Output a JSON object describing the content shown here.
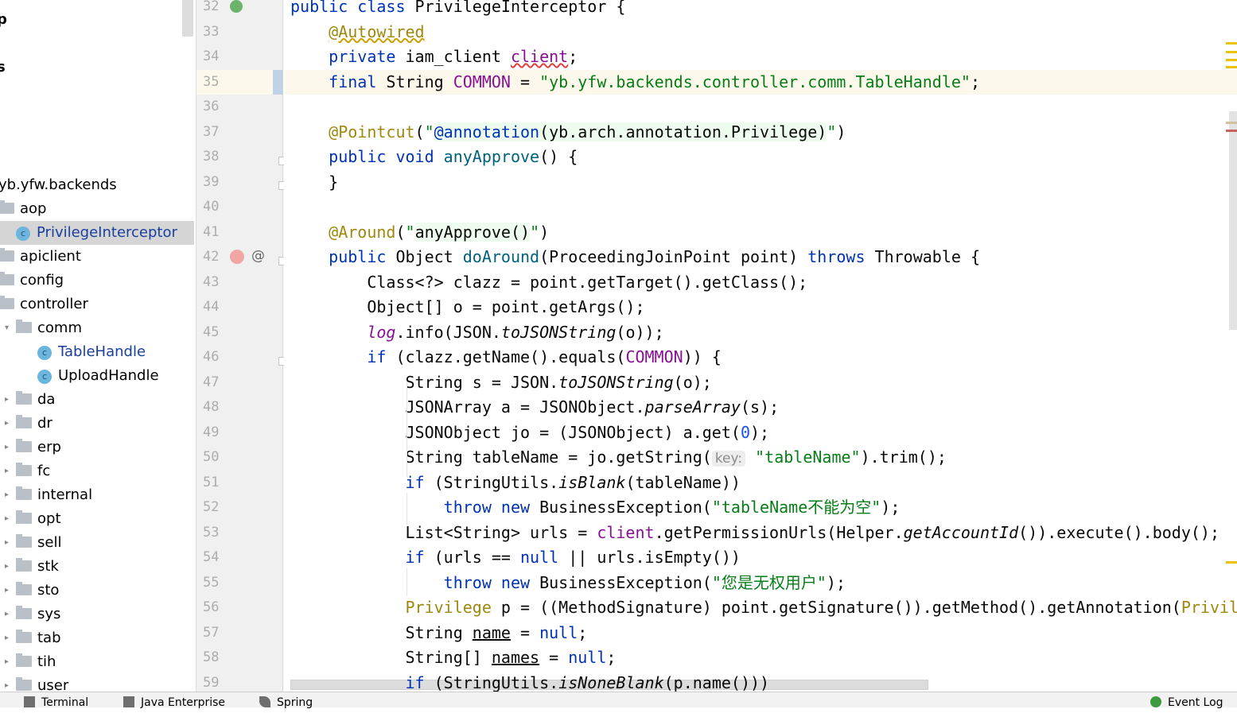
{
  "project_tree": {
    "items": [
      {
        "label": "p",
        "type": "partial",
        "indent": 0,
        "bold": true
      },
      {
        "label": "s",
        "type": "partial",
        "indent": 0,
        "bold": true
      },
      {
        "label": "yb.yfw.backends",
        "type": "package",
        "indent": 0
      },
      {
        "label": "aop",
        "type": "folder",
        "indent": 0,
        "expanded": true
      },
      {
        "label": "PrivilegeInterceptor",
        "type": "class",
        "indent": 1,
        "selected": true
      },
      {
        "label": "apiclient",
        "type": "folder",
        "indent": 0
      },
      {
        "label": "config",
        "type": "folder",
        "indent": 0
      },
      {
        "label": "controller",
        "type": "folder",
        "indent": 0
      },
      {
        "label": "comm",
        "type": "folder",
        "indent": 1,
        "expanded": true
      },
      {
        "label": "TableHandle",
        "type": "class",
        "indent": 2
      },
      {
        "label": "UploadHandle",
        "type": "class",
        "indent": 2
      },
      {
        "label": "da",
        "type": "folder",
        "indent": 1
      },
      {
        "label": "dr",
        "type": "folder",
        "indent": 1
      },
      {
        "label": "erp",
        "type": "folder",
        "indent": 1
      },
      {
        "label": "fc",
        "type": "folder",
        "indent": 1
      },
      {
        "label": "internal",
        "type": "folder",
        "indent": 1
      },
      {
        "label": "opt",
        "type": "folder",
        "indent": 1
      },
      {
        "label": "sell",
        "type": "folder",
        "indent": 1
      },
      {
        "label": "stk",
        "type": "folder",
        "indent": 1
      },
      {
        "label": "sto",
        "type": "folder",
        "indent": 1
      },
      {
        "label": "sys",
        "type": "folder",
        "indent": 1
      },
      {
        "label": "tab",
        "type": "folder",
        "indent": 1
      },
      {
        "label": "tih",
        "type": "folder",
        "indent": 1
      },
      {
        "label": "user",
        "type": "folder",
        "indent": 1
      }
    ]
  },
  "editor": {
    "current_line": "35",
    "lines": [
      {
        "n": "32",
        "tokens": [
          [
            "public class ",
            "kw"
          ],
          [
            "PrivilegeInterceptor {",
            ""
          ]
        ]
      },
      {
        "n": "33",
        "tokens": [
          [
            "    ",
            ""
          ],
          [
            "@Autowired",
            "ann wavy"
          ]
        ]
      },
      {
        "n": "34",
        "tokens": [
          [
            "    ",
            ""
          ],
          [
            "private ",
            "kw"
          ],
          [
            "iam_client ",
            ""
          ],
          [
            "client",
            "field wavyr"
          ],
          [
            ";",
            ""
          ]
        ]
      },
      {
        "n": "35",
        "tokens": [
          [
            "    ",
            ""
          ],
          [
            "final ",
            "kw"
          ],
          [
            "String ",
            ""
          ],
          [
            "COMMON",
            "field"
          ],
          [
            " = ",
            ""
          ],
          [
            "\"yb.yfw.backends.controller.comm.TableHandle\"",
            "str"
          ],
          [
            ";",
            ""
          ]
        ]
      },
      {
        "n": "36",
        "tokens": []
      },
      {
        "n": "37",
        "tokens": [
          [
            "    ",
            ""
          ],
          [
            "@Pointcut",
            "ann"
          ],
          [
            "(",
            ""
          ],
          [
            "\"",
            "str"
          ],
          [
            "@annotation",
            "kw inj"
          ],
          [
            "(yb.arch.annotation.Privilege)",
            "inj"
          ],
          [
            "\"",
            "str"
          ],
          [
            ")",
            ""
          ]
        ]
      },
      {
        "n": "38",
        "tokens": [
          [
            "    ",
            ""
          ],
          [
            "public void ",
            "kw"
          ],
          [
            "anyApprove",
            "fn"
          ],
          [
            "() {",
            ""
          ]
        ]
      },
      {
        "n": "39",
        "tokens": [
          [
            "    }",
            ""
          ]
        ]
      },
      {
        "n": "40",
        "tokens": []
      },
      {
        "n": "41",
        "tokens": [
          [
            "    ",
            ""
          ],
          [
            "@Around",
            "ann"
          ],
          [
            "(",
            ""
          ],
          [
            "\"",
            "str"
          ],
          [
            "anyApprove()",
            "inj"
          ],
          [
            "\"",
            "str"
          ],
          [
            ")",
            ""
          ]
        ]
      },
      {
        "n": "42",
        "tokens": [
          [
            "    ",
            ""
          ],
          [
            "public ",
            "kw"
          ],
          [
            "Object ",
            ""
          ],
          [
            "doAround",
            "fn"
          ],
          [
            "(ProceedingJoinPoint point) ",
            ""
          ],
          [
            "throws ",
            "kw"
          ],
          [
            "Throwable {",
            ""
          ]
        ]
      },
      {
        "n": "43",
        "tokens": [
          [
            "        Class<?> clazz = point.getTarget().getClass();",
            ""
          ]
        ]
      },
      {
        "n": "44",
        "tokens": [
          [
            "        Object[] o = point.getArgs();",
            ""
          ]
        ]
      },
      {
        "n": "45",
        "tokens": [
          [
            "        ",
            ""
          ],
          [
            "log",
            "fi"
          ],
          [
            ".info(JSON.",
            ""
          ],
          [
            "toJSONString",
            "it"
          ],
          [
            "(o));",
            ""
          ]
        ]
      },
      {
        "n": "46",
        "tokens": [
          [
            "        ",
            ""
          ],
          [
            "if ",
            "kw"
          ],
          [
            "(clazz.getName().equals(",
            ""
          ],
          [
            "COMMON",
            "field"
          ],
          [
            ")) {",
            ""
          ]
        ]
      },
      {
        "n": "47",
        "tokens": [
          [
            "            String s = JSON.",
            ""
          ],
          [
            "toJSONString",
            "it"
          ],
          [
            "(o);",
            ""
          ]
        ]
      },
      {
        "n": "48",
        "tokens": [
          [
            "            JSONArray a = JSONObject.",
            ""
          ],
          [
            "parseArray",
            "it"
          ],
          [
            "(s);",
            ""
          ]
        ]
      },
      {
        "n": "49",
        "tokens": [
          [
            "            JSONObject jo = (JSONObject) a.get(",
            ""
          ],
          [
            "0",
            "num"
          ],
          [
            ");",
            ""
          ]
        ]
      },
      {
        "n": "50",
        "tokens": [
          [
            "            String tableName = jo.getString(",
            ""
          ],
          [
            "key:",
            "hint"
          ],
          [
            " ",
            ""
          ],
          [
            "\"tableName\"",
            "str"
          ],
          [
            ").trim();",
            ""
          ]
        ]
      },
      {
        "n": "51",
        "tokens": [
          [
            "            ",
            ""
          ],
          [
            "if ",
            "kw"
          ],
          [
            "(StringUtils.",
            ""
          ],
          [
            "isBlank",
            "it"
          ],
          [
            "(tableName))",
            ""
          ]
        ]
      },
      {
        "n": "52",
        "tokens": [
          [
            "                ",
            ""
          ],
          [
            "throw new ",
            "kw"
          ],
          [
            "BusinessException(",
            ""
          ],
          [
            "\"tableName不能为空\"",
            "str"
          ],
          [
            ");",
            ""
          ]
        ]
      },
      {
        "n": "53",
        "tokens": [
          [
            "            List<String> urls = ",
            ""
          ],
          [
            "client",
            "field"
          ],
          [
            ".getPermissionUrls(Helper.",
            ""
          ],
          [
            "getAccountId",
            "it"
          ],
          [
            "()).execute().body();",
            ""
          ]
        ]
      },
      {
        "n": "54",
        "tokens": [
          [
            "            ",
            ""
          ],
          [
            "if ",
            "kw"
          ],
          [
            "(urls == ",
            ""
          ],
          [
            "null",
            "kw"
          ],
          [
            " || urls.isEmpty())",
            ""
          ]
        ]
      },
      {
        "n": "55",
        "tokens": [
          [
            "                ",
            ""
          ],
          [
            "throw new ",
            "kw"
          ],
          [
            "BusinessException(",
            ""
          ],
          [
            "\"您是无权用户\"",
            "str"
          ],
          [
            ");",
            ""
          ]
        ]
      },
      {
        "n": "56",
        "tokens": [
          [
            "            ",
            ""
          ],
          [
            "Privilege",
            "ann"
          ],
          [
            " p = ((MethodSignature) point.getSignature()).getMethod().getAnnotation(",
            ""
          ],
          [
            "Privil",
            "ann"
          ]
        ]
      },
      {
        "n": "57",
        "tokens": [
          [
            "            String ",
            ""
          ],
          [
            "name",
            "ul"
          ],
          [
            " = ",
            ""
          ],
          [
            "null",
            "kw"
          ],
          [
            ";",
            ""
          ]
        ]
      },
      {
        "n": "58",
        "tokens": [
          [
            "            String[] ",
            ""
          ],
          [
            "names",
            "ul"
          ],
          [
            " = ",
            ""
          ],
          [
            "null",
            "kw"
          ],
          [
            ";",
            ""
          ]
        ]
      },
      {
        "n": "59",
        "tokens": [
          [
            "            ",
            ""
          ],
          [
            "if ",
            "kw"
          ],
          [
            "(StringUtils.",
            ""
          ],
          [
            "isNoneBlank",
            "it"
          ],
          [
            "(p.name()))",
            ""
          ]
        ]
      }
    ]
  },
  "bottom_bar": {
    "terminal": "Terminal",
    "java_enterprise": "Java Enterprise",
    "spring": "Spring",
    "event_log": "Event Log"
  },
  "colors": {
    "keyword": "#0033b3",
    "annotation": "#9e880d",
    "string": "#067d17",
    "field": "#871094",
    "method": "#00627a",
    "selection": "#d5d5d5"
  }
}
